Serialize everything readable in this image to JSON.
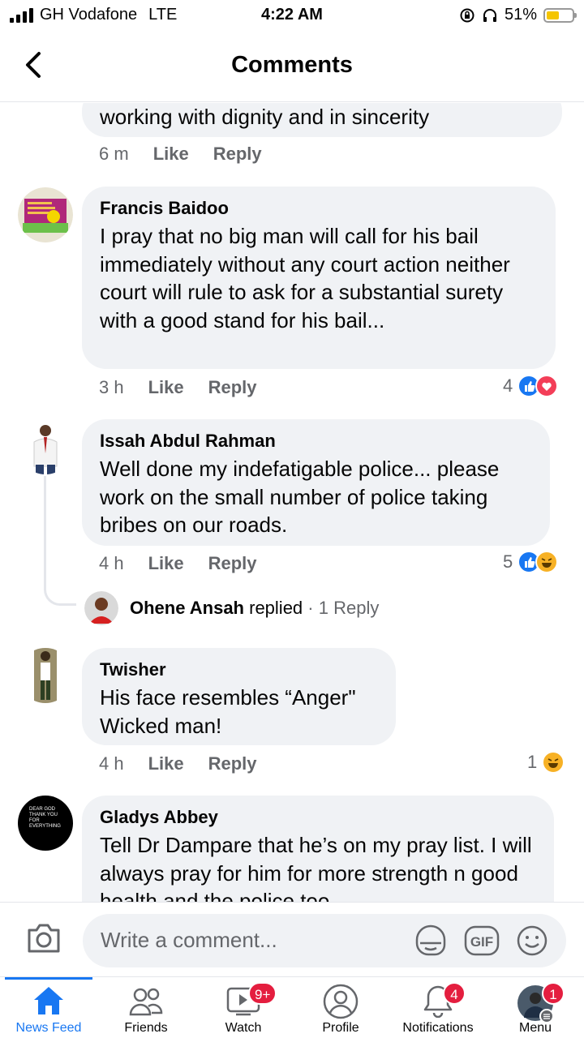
{
  "status_bar": {
    "carrier": "GH Vodafone",
    "network": "LTE",
    "time": "4:22 AM",
    "battery": "51%",
    "battery_level": 0.51
  },
  "header": {
    "title": "Comments"
  },
  "comments": [
    {
      "text": "working with dignity and in sincerity",
      "time": "6 m",
      "like": "Like",
      "reply": "Reply"
    },
    {
      "author": "Francis Baidoo",
      "text": "I pray that no big man will call for his bail immediately without any court action neither court will rule to ask for a substantial surety with a good stand for his bail...",
      "time": "3 h",
      "like": "Like",
      "reply": "Reply",
      "reactions": "4"
    },
    {
      "author": "Issah Abdul Rahman",
      "text": "Well done my indefatigable police... please work on the small number of police taking bribes on our roads.",
      "time": "4 h",
      "like": "Like",
      "reply": "Reply",
      "reactions": "5",
      "reply_preview": {
        "name": "Ohene Ansah",
        "action": "replied",
        "count": "· 1 Reply"
      }
    },
    {
      "author": "Twisher",
      "text": "His face resembles “Anger\" Wicked man!",
      "time": "4 h",
      "like": "Like",
      "reply": "Reply",
      "reactions": "1"
    },
    {
      "author": "Gladys Abbey",
      "text": "Tell Dr Dampare that he’s on my pray list. I will always pray for him for more strength n good health and the police too",
      "avatar_text": "DEAR GOD THANK YOU FOR EVERYTHING"
    }
  ],
  "composer": {
    "placeholder": "Write a comment..."
  },
  "nav": [
    {
      "label": "News Feed",
      "active": true
    },
    {
      "label": "Friends"
    },
    {
      "label": "Watch",
      "badge": "9+"
    },
    {
      "label": "Profile"
    },
    {
      "label": "Notifications",
      "badge": "4"
    },
    {
      "label": "Menu",
      "badge": "1"
    }
  ],
  "colors": {
    "accent": "#1877f2",
    "bubble": "#f0f2f5",
    "badge": "#e41e3f",
    "secondary_text": "#65676b"
  }
}
